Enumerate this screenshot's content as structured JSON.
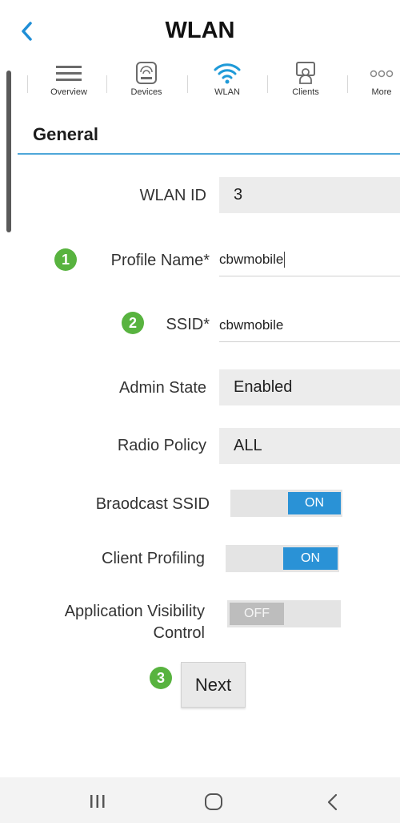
{
  "header": {
    "title": "WLAN"
  },
  "nav": {
    "items": [
      {
        "label": "Overview",
        "icon": "menu-icon"
      },
      {
        "label": "Devices",
        "icon": "devices-icon"
      },
      {
        "label": "WLAN",
        "icon": "wifi-icon"
      },
      {
        "label": "Clients",
        "icon": "clients-icon"
      },
      {
        "label": "More",
        "icon": "more-icon"
      }
    ],
    "active": "WLAN"
  },
  "section": {
    "title": "General"
  },
  "form": {
    "wlan_id": {
      "label": "WLAN ID",
      "value": "3"
    },
    "profile_name": {
      "label": "Profile Name*",
      "value": "cbwmobile",
      "step": "1"
    },
    "ssid": {
      "label": "SSID*",
      "value": "cbwmobile",
      "step": "2"
    },
    "admin_state": {
      "label": "Admin State",
      "value": "Enabled"
    },
    "radio_policy": {
      "label": "Radio Policy",
      "value": "ALL"
    },
    "broadcast_ssid": {
      "label": "Braodcast SSID",
      "state": "ON"
    },
    "client_profiling": {
      "label": "Client Profiling",
      "state": "ON"
    },
    "avc": {
      "label_line1": "Application Visibility",
      "label_line2": "Control",
      "state": "OFF"
    }
  },
  "next": {
    "label": "Next",
    "step": "3"
  },
  "colors": {
    "accent": "#2a92d6",
    "badge": "#58b33f",
    "rule": "#4fa7d9"
  }
}
